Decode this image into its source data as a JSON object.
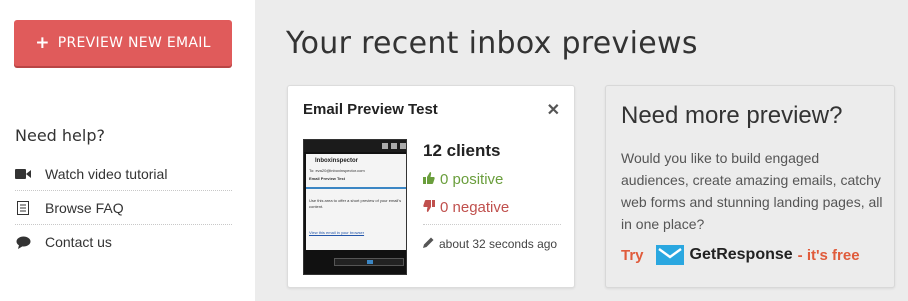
{
  "sidebar": {
    "new_preview_button": {
      "icon": "plus-icon",
      "label": "PREVIEW NEW EMAIL",
      "color": "#e05b5b"
    },
    "help_title": "Need help?",
    "help_items": [
      {
        "icon": "video-camera-icon",
        "label": "Watch video tutorial"
      },
      {
        "icon": "document-icon",
        "label": "Browse FAQ"
      },
      {
        "icon": "speech-bubble-icon",
        "label": "Contact us"
      }
    ]
  },
  "main": {
    "title": "Your recent inbox previews",
    "preview_card": {
      "title": "Email Preview Test",
      "close_icon": "close-icon",
      "thumbnail": {
        "brand": "Inboxinspector",
        "to_line": "To: eva20@inboxinspector.com",
        "subject": "Email Preview Test",
        "body": "Use this area to offer a short preview of your email's content.",
        "link": "View this email in your browser"
      },
      "clients": "12 clients",
      "positive": "0 positive",
      "negative": "0 negative",
      "updated": "about 32 seconds ago",
      "colors": {
        "positive": "#6a9e3c",
        "negative": "#c0504d"
      }
    },
    "promo": {
      "title": "Need more preview?",
      "text": "Would you like to build engaged audiences, create amazing emails, catchy web forms and stunning landing pages, all in one place?",
      "cta_try": "Try",
      "brand": "GetResponse",
      "cta_free": "- it's free",
      "accent": "#e05b3b",
      "brand_color": "#2aa7e0"
    }
  }
}
